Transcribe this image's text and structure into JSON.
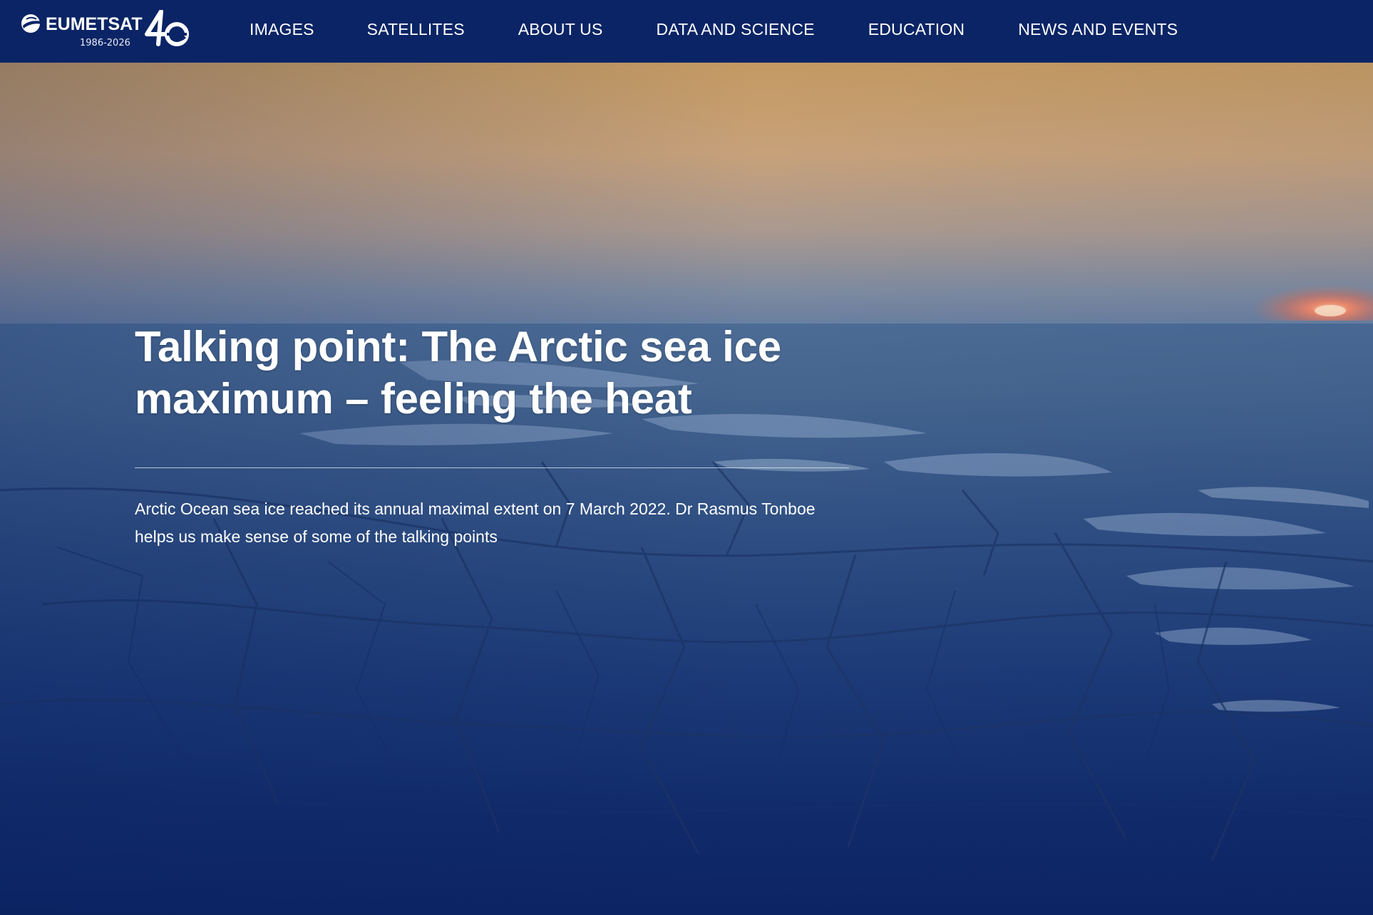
{
  "header": {
    "brand": {
      "name": "EUMETSAT",
      "years": "1986-2026",
      "anniversary_icon": "forty-years-anniversary-icon"
    },
    "nav": [
      {
        "label": "IMAGES"
      },
      {
        "label": "SATELLITES"
      },
      {
        "label": "ABOUT US"
      },
      {
        "label": "DATA AND SCIENCE"
      },
      {
        "label": "EDUCATION"
      },
      {
        "label": "NEWS AND EVENTS"
      }
    ]
  },
  "hero": {
    "title": "Talking point: The Arctic sea ice maximum – feeling the heat",
    "summary": "Arctic Ocean sea ice reached its annual maximal extent on 7 March 2022. Dr Rasmus Tonboe helps us make sense of some of the talking points",
    "image": "arctic-sea-ice-sunset-photo"
  },
  "colors": {
    "header_bg": "#0a2465",
    "page_bg": "#0b2260",
    "sky_top": "#c5a06a",
    "sea_mid": "#3c5f8e",
    "sea_bottom": "#0d2462",
    "text": "#ffffff"
  }
}
